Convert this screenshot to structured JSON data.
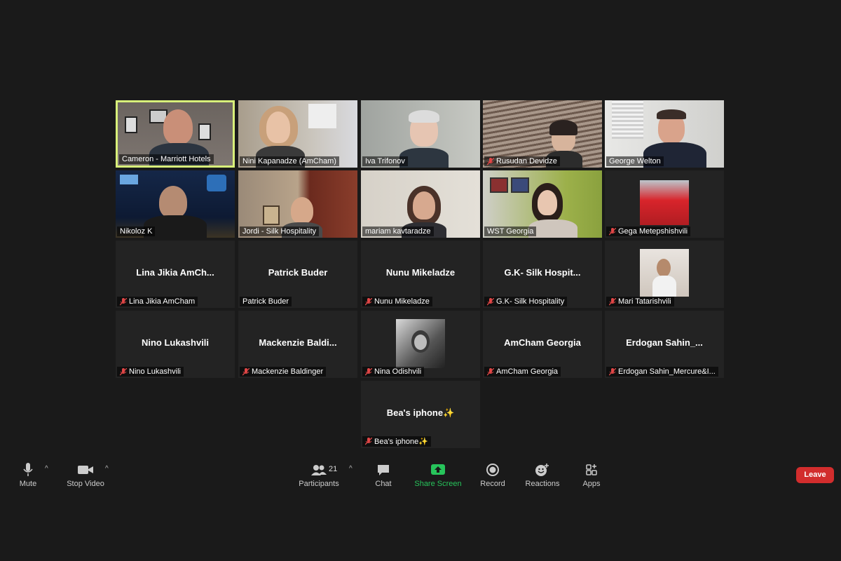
{
  "participants_grid": {
    "tiles": [
      {
        "name": "Cameron - Marriott Hotels"
      },
      {
        "name": "Nini Kapanadze (AmCham)"
      },
      {
        "name": "Iva Trifonov"
      },
      {
        "name": "Rusudan Devidze"
      },
      {
        "name": "George Welton"
      },
      {
        "name": "Nikoloz K"
      },
      {
        "name": "Jordi - Silk Hospitality"
      },
      {
        "name": "mariam kavtaradze"
      },
      {
        "name": "WST Georgia"
      },
      {
        "name": "Gega Metepshishvili"
      },
      {
        "name": "Lina Jikia AmCham",
        "display": "Lina Jikia AmCh..."
      },
      {
        "name": "Patrick Buder",
        "display": "Patrick Buder"
      },
      {
        "name": "Nunu Mikeladze",
        "display": "Nunu Mikeladze"
      },
      {
        "name": "G.K- Silk Hospitality",
        "display": "G.K- Silk Hospit..."
      },
      {
        "name": "Mari Tatarishvili"
      },
      {
        "name": "Nino Lukashvili",
        "display": "Nino Lukashvili"
      },
      {
        "name": "Mackenzie Baldinger",
        "display": "Mackenzie  Baldi..."
      },
      {
        "name": "Nina Odishvili"
      },
      {
        "name": "AmCham Georgia",
        "display": "AmCham Georgia"
      },
      {
        "name": "Erdogan Sahin_Mercure&I...",
        "display": "Erdogan  Sahin_..."
      },
      {
        "name": "Bea's  iphone✨",
        "display": "Bea's  iphone✨"
      }
    ]
  },
  "toolbar": {
    "mute": "Mute",
    "stop_video": "Stop Video",
    "participants": "Participants",
    "participants_count": "21",
    "chat": "Chat",
    "share_screen": "Share Screen",
    "record": "Record",
    "reactions": "Reactions",
    "apps": "Apps",
    "leave": "Leave"
  },
  "colors": {
    "background": "#1a1a1a",
    "tile": "#232323",
    "active_speaker_border": "#d8f07a",
    "share_green": "#27c45b",
    "leave_red": "#d22d2d",
    "muted_red": "#e04646"
  }
}
